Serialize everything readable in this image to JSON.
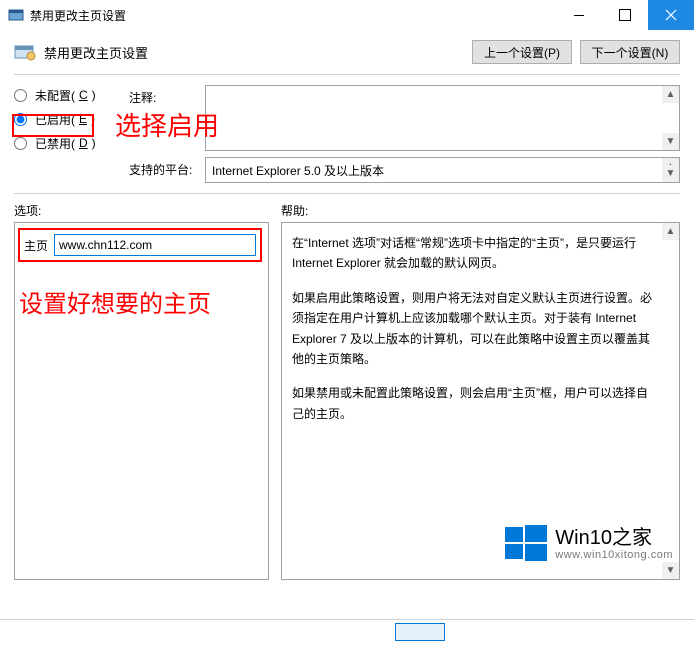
{
  "window": {
    "title": "禁用更改主页设置"
  },
  "header": {
    "title": "禁用更改主页设置",
    "prev_label": "上一个设置(P)",
    "next_label": "下一个设置(N)"
  },
  "radios": {
    "not_configured": "未配置(",
    "not_configured_u": "C",
    "not_configured_end": ")",
    "enabled": "已启用(",
    "enabled_u": "E",
    "enabled_end": ")",
    "disabled": "已禁用(",
    "disabled_u": "D",
    "disabled_end": ")"
  },
  "labels": {
    "comment": "注释:",
    "platform": "支持的平台:",
    "options": "选项:",
    "help": "帮助:",
    "homepage": "主页"
  },
  "values": {
    "platform": "Internet Explorer 5.0 及以上版本",
    "homepage": "www.chn112.com"
  },
  "help": {
    "p1": "在“Internet 选项”对话框“常规”选项卡中指定的“主页”，是只要运行 Internet Explorer 就会加载的默认网页。",
    "p2": "如果启用此策略设置，则用户将无法对自定义默认主页进行设置。必须指定在用户计算机上应该加载哪个默认主页。对于装有 Internet Explorer 7 及以上版本的计算机，可以在此策略中设置主页以覆盖其他的主页策略。",
    "p3": "如果禁用或未配置此策略设置，则会启用“主页”框，用户可以选择自己的主页。"
  },
  "annotations": {
    "select_enable": "选择启用",
    "set_homepage": "设置好想要的主页"
  },
  "watermark": {
    "brand": "Win10之家",
    "url": "www.win10xitong.com"
  }
}
